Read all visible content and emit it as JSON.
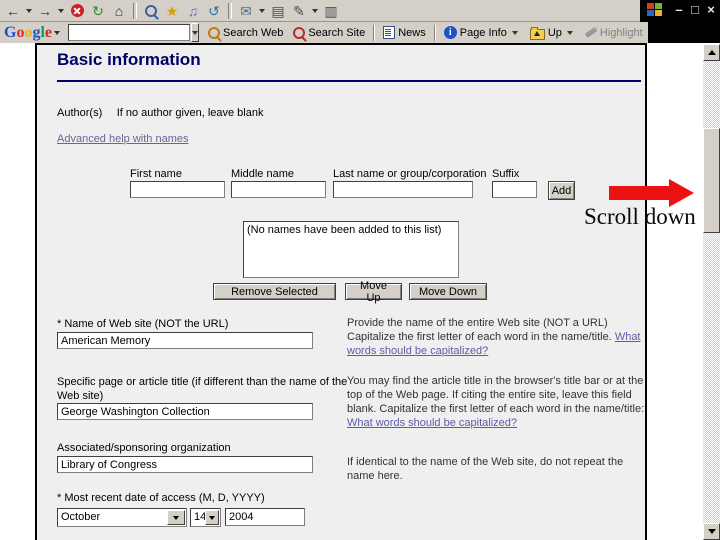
{
  "colors": {
    "accent_navy": "#000066",
    "link_purple": "#666699",
    "help_link_blue": "#5c5caa",
    "arrow_red": "#ee1111",
    "toolbar_gray": "#d4d0c8",
    "page_bg": "#efefef"
  },
  "window": {
    "controls": {
      "minimize": "–",
      "restore": "□",
      "close": "×"
    }
  },
  "ie_toolbar": {
    "buttons": [
      {
        "id": "back",
        "glyph": "←"
      },
      {
        "id": "forward",
        "glyph": "→"
      },
      {
        "id": "stop",
        "glyph": ""
      },
      {
        "id": "refresh",
        "glyph": "↻"
      },
      {
        "id": "home",
        "glyph": "⌂"
      },
      {
        "id": "search",
        "glyph": ""
      },
      {
        "id": "favorites",
        "glyph": "★"
      },
      {
        "id": "media",
        "glyph": "♫"
      },
      {
        "id": "history",
        "glyph": "↺"
      },
      {
        "id": "mail",
        "glyph": "✉"
      },
      {
        "id": "print",
        "glyph": "▤"
      },
      {
        "id": "edit",
        "glyph": "✎"
      },
      {
        "id": "discuss",
        "glyph": "▥"
      }
    ]
  },
  "google_toolbar": {
    "logo_letters": [
      "G",
      "o",
      "o",
      "g",
      "l",
      "e"
    ],
    "search_value": "",
    "info_glyph": "i",
    "labels": {
      "search_web": "Search Web",
      "search_site": "Search Site",
      "news": "News",
      "page_info": "Page Info",
      "up": "Up",
      "highlight": "Highlight"
    }
  },
  "form": {
    "heading": "Basic information",
    "author_label": "Author(s)",
    "author_hint": "If no author given, leave blank",
    "advanced_help_link": "Advanced help with names",
    "name_fields": {
      "first": "First name",
      "middle": "Middle name",
      "last": "Last name or group/corporation",
      "suffix": "Suffix",
      "add_button": "Add"
    },
    "names_list_empty": "(No names have been added to this list)",
    "list_buttons": {
      "remove": "Remove Selected",
      "move_up": "Move Up",
      "move_down": "Move Down"
    },
    "site_name": {
      "label": "* Name of Web site (NOT the URL)",
      "value": "American Memory",
      "help_text": "Provide the name of the entire Web site (NOT a URL) Capitalize the first letter of each word in the name/title. ",
      "help_link": "What words should be capitalized?"
    },
    "article_title": {
      "label": "Specific page or article title (if different than the name of the Web site)",
      "value": "George Washington Collection",
      "help_text": "You may find the article title in the browser's title bar or at the top of the Web page. If citing the entire site, leave this field blank. Capitalize the first letter of each word in the name/title: ",
      "help_link": "What words should be capitalized?"
    },
    "organization": {
      "label": "Associated/sponsoring organization",
      "value": "Library of Congress",
      "help_text": "If identical to the name of the Web site, do not repeat the name here."
    },
    "access_date": {
      "label": "* Most recent date of access (M, D, YYYY)",
      "month": "October",
      "day": "14",
      "year": "2004"
    }
  },
  "annotation": {
    "scroll_down": "Scroll down"
  }
}
